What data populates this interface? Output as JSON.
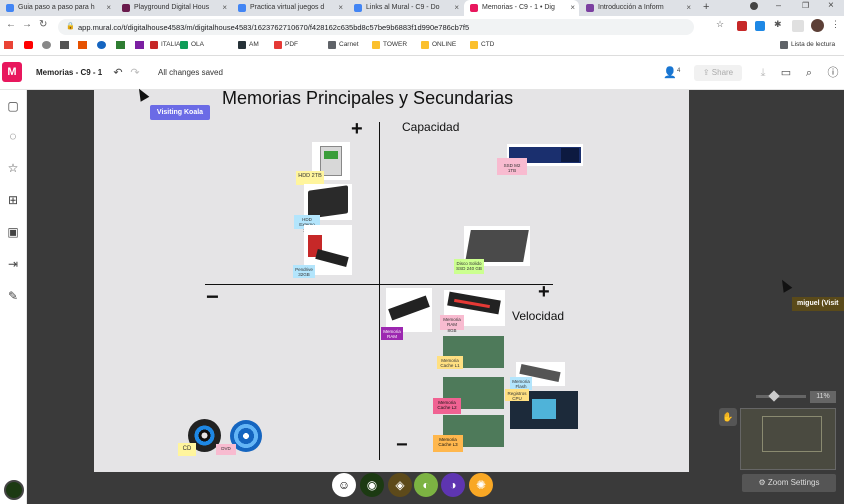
{
  "browser": {
    "tabs": [
      {
        "title": "Guia paso a paso para h",
        "color": "#4285f4"
      },
      {
        "title": "Playground Digital Hous",
        "color": "#6a1b4d"
      },
      {
        "title": "Practica virtual juegos d",
        "color": "#4285f4"
      },
      {
        "title": "Links al Mural - C9 - Do",
        "color": "#4285f4"
      },
      {
        "title": "Memorias - C9 - 1 • Dig",
        "color": "#e8175d"
      },
      {
        "title": "Introducción a Inform",
        "color": "#7b3fa0"
      }
    ],
    "url": "app.mural.co/t/digitalhouse4583/m/digitalhouse4583/1623762710670/f428162c635bd8c57be9b6883f1d990e786cb7f5",
    "bookmarks": [
      "ITALIA",
      "OLA",
      "AM",
      "PDF",
      "Carnet",
      "TOWER",
      "ONLINE",
      "CTD"
    ],
    "reading_list": "Lista de lectura"
  },
  "mural": {
    "logo": "M",
    "title": "Memorias - C9 - 1",
    "saved_status": "All changes saved",
    "collaborators_count": "4",
    "share_label": "Share",
    "zoom_percent": "11%",
    "zoom_settings_label": "Zoom Settings"
  },
  "board": {
    "title": "Memorias Principales y Secundarias",
    "axis_y_label": "Capacidad",
    "axis_x_label": "Velocidad",
    "plus_sign": "+",
    "minus_sign": "−",
    "visiting_tag": "Visiting Koala",
    "cursor_tag": "miguel (Visit",
    "stickies": {
      "hdd": "HDD 2TB",
      "hdd_ext": "HDD Externo 1TB",
      "pendrive": "Pendrive 32GB",
      "ssd_m2": "SSD M2 1TB",
      "ssd": "Disco Solido SSD 240 GB",
      "ram_old": "Memoria RAM",
      "ram_new": "Memoria RAM 8GB",
      "cache_l1": "Memoria Cache L1",
      "cache_l2": "Memoria Cache L2",
      "cache_l3": "Memoria Cache L3",
      "flash": "Memoria Flash",
      "cpu_reg": "Registros CPU",
      "cd": "CD",
      "dvd": "DVD"
    }
  },
  "reactions": [
    "smile",
    "koala",
    "owl",
    "chameleon",
    "bird",
    "lion"
  ]
}
